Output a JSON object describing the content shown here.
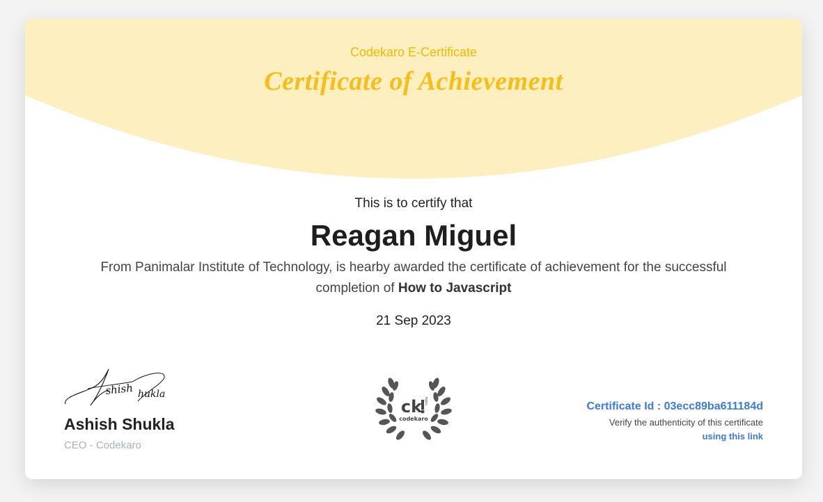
{
  "header": {
    "subtitle": "Codekaro E-Certificate",
    "title": "Certificate of Achievement"
  },
  "body": {
    "certify_line": "This is to certify that",
    "recipient_name": "Reagan Miguel",
    "description_prefix": "From Panimalar Institute of Technology, is hearby awarded the certificate of achievement for the successful completion of ",
    "course_name": "How to Javascript",
    "date": "21 Sep 2023"
  },
  "signatory": {
    "signature_text": "Ashish Shukla",
    "name": "Ashish Shukla",
    "title": "CEO - Codekaro"
  },
  "seal": {
    "logo_text": "ck",
    "brand": "codekaro",
    "side_text": "india"
  },
  "verification": {
    "certificate_id": "Certificate Id : 03ecc89ba611184d",
    "verify_text": "Verify the authenticity of this certificate",
    "link_label": "using this link"
  },
  "colors": {
    "banner": "#fdefc0",
    "title": "#f7be1a",
    "link": "#3d7ad8"
  }
}
